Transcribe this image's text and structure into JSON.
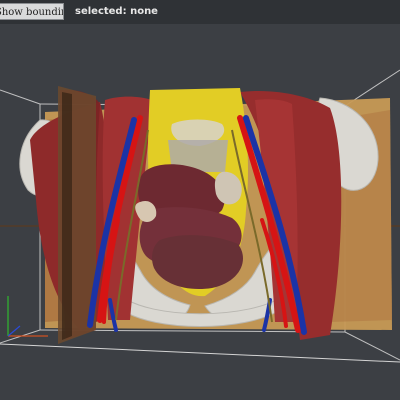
{
  "toolbar": {
    "bbox_button_label": "Show bounding box",
    "selection_label": "selected:",
    "selection_value": "none"
  },
  "colors": {
    "background": "#3c3f44",
    "toolbar": "#2f3236",
    "bbox_line": "#d0d0d0",
    "muscle": "#9b2b2b",
    "bone": "#d8d6d0",
    "fat": "#e6d22a",
    "artery": "#d61414",
    "vein": "#1832a6",
    "organ": "#6e2a30",
    "axis_x": "#d05020",
    "axis_y": "#2fb82f",
    "axis_z": "#2b4bd8"
  },
  "icons": [
    "axis-gizmo-icon"
  ]
}
